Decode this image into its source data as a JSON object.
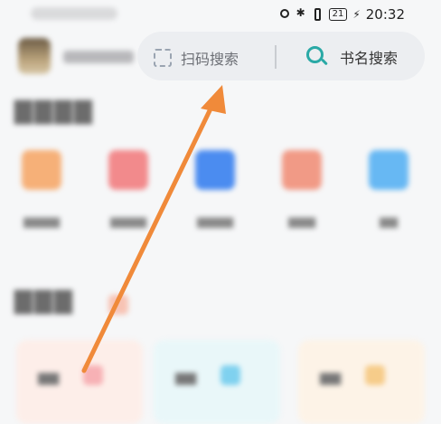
{
  "status_bar": {
    "time": "20:32",
    "battery": "21"
  },
  "search_bar": {
    "scan_label": "扫码搜索",
    "book_label": "书名搜索"
  },
  "colors": {
    "arrow": "#f08a3a",
    "search_accent": "#2aa9a6"
  },
  "tools": [
    {
      "icon": "grid-icon",
      "color": "#f6b078"
    },
    {
      "icon": "red-tool-icon",
      "color": "#f28a8c"
    },
    {
      "icon": "blue-tool-icon",
      "color": "#4b8cf0"
    },
    {
      "icon": "notebook-icon",
      "color": "#f19a86"
    },
    {
      "icon": "notes-icon",
      "color": "#67b8f3"
    }
  ],
  "cards": [
    {
      "bg": "#fdeee9",
      "badge": "#f7b1b5"
    },
    {
      "bg": "#e9f7f9",
      "badge": "#7fd1ef"
    },
    {
      "bg": "#fdf3e7",
      "badge": "#f6cc8a"
    }
  ]
}
